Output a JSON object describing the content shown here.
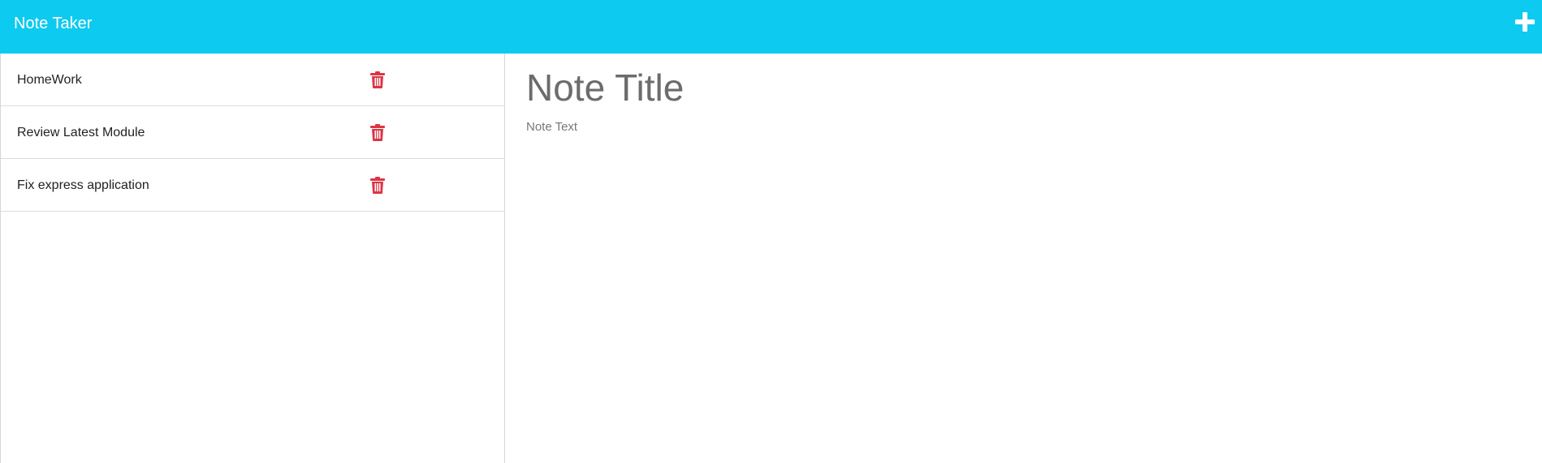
{
  "navbar": {
    "title": "Note Taker",
    "add_icon": "plus-icon",
    "background_color": "#0dcaf0"
  },
  "notes": [
    {
      "title": "HomeWork",
      "delete_icon": "trash-icon"
    },
    {
      "title": "Review Latest Module",
      "delete_icon": "trash-icon"
    },
    {
      "title": "Fix express application",
      "delete_icon": "trash-icon"
    }
  ],
  "editor": {
    "title_placeholder": "Note Title",
    "text_placeholder": "Note Text"
  },
  "colors": {
    "delete_icon": "#dc3545",
    "accent": "#0dcaf0"
  }
}
